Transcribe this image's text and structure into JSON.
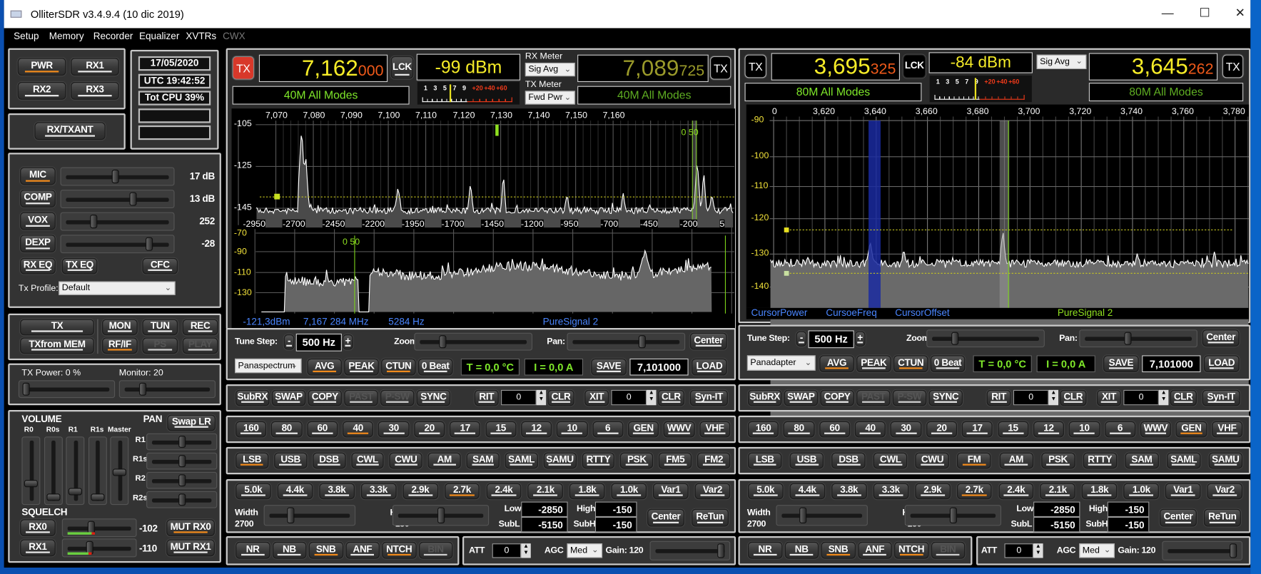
{
  "window": {
    "title": "OlliterSDR v3.4.9.4 (10 dic 2019)",
    "controls": [
      "minimize-icon",
      "maximize-icon",
      "close-icon"
    ]
  },
  "menu": [
    {
      "label": "Setup"
    },
    {
      "label": "Memory"
    },
    {
      "label": "Recorder"
    },
    {
      "label": "Equalizer"
    },
    {
      "label": "XVTRs"
    },
    {
      "label": "CWX",
      "disabled": true
    }
  ],
  "colors": {
    "accent_on": "#f08a1c",
    "freq": "#f6ec28",
    "freq_sub": "#f05a1a",
    "band_label": "#7fe82a",
    "status_text": "#4a86ff",
    "tx_active": "#d8382a"
  },
  "left": {
    "rx_buttons": [
      {
        "label": "PWR",
        "on": true
      },
      {
        "label": "RX1"
      },
      {
        "label": "RX2"
      },
      {
        "label": "RX3"
      }
    ],
    "status": [
      "17/05/2020",
      "UTC 19:42:52",
      "Tot CPU 39%",
      "",
      ""
    ],
    "rxtx_ant": {
      "label": "RX/TXANT"
    },
    "audio": [
      {
        "label": "MIC",
        "on": true,
        "value": "17 dB",
        "level": 0.48
      },
      {
        "label": "COMP",
        "value": "13 dB",
        "level": 0.66
      },
      {
        "label": "VOX",
        "value": "252",
        "level": 0.26
      },
      {
        "label": "DEXP",
        "value": "-28",
        "level": 0.82
      }
    ],
    "eq_buttons": [
      {
        "label": "RX EQ"
      },
      {
        "label": "TX EQ"
      },
      {
        "label": "CFC"
      }
    ],
    "tx_profile": {
      "label": "Tx Profile:",
      "value": "Default"
    },
    "tx_buttons": [
      {
        "label": "TX"
      },
      {
        "label": "TXfrom MEM"
      },
      {
        "label": "MON"
      },
      {
        "label": "TUN"
      },
      {
        "label": "REC"
      },
      {
        "label": "RF/IF",
        "on": true
      },
      {
        "label": "PS",
        "disabled": true
      },
      {
        "label": "PLAY",
        "disabled": true
      }
    ],
    "tx_power": {
      "label": "TX Power:  0 %",
      "level": 0.0
    },
    "monitor": {
      "label": "Monitor: 20",
      "level": 0.2
    },
    "volume": {
      "title": "VOLUME",
      "channels": [
        {
          "label": "R0",
          "level": 0.25
        },
        {
          "label": "R0s",
          "level": 0.0
        },
        {
          "label": "R1",
          "level": 0.1
        },
        {
          "label": "R1s",
          "level": 0.0
        },
        {
          "label": "Master",
          "level": 0.45
        }
      ]
    },
    "pan": {
      "title": "PAN",
      "swap": {
        "label": "Swap LR"
      },
      "channels": [
        {
          "label": "R1",
          "level": 0.5
        },
        {
          "label": "R1s",
          "level": 0.5
        },
        {
          "label": "R2",
          "level": 0.5
        },
        {
          "label": "R2s",
          "level": 0.5
        }
      ]
    },
    "squelch": {
      "title": "SQUELCH",
      "rows": [
        {
          "button": {
            "label": "RX0"
          },
          "value": "-102",
          "level": 0.36,
          "signal": 0.38,
          "mute": {
            "label": "MUT RX0",
            "on": true
          }
        },
        {
          "button": {
            "label": "RX1"
          },
          "value": "-110",
          "level": 0.34,
          "signal": 0.33,
          "mute": {
            "label": "MUT RX1"
          }
        }
      ]
    }
  },
  "rx": [
    {
      "tx": {
        "label": "TX",
        "active": true
      },
      "freq_main": "7,162",
      "freq_sub": "000",
      "lock": {
        "label": "LCK"
      },
      "meter_reading": "-99 dBm",
      "meter_scale": [
        "1",
        "3",
        "5",
        "7",
        "9",
        "+20",
        "+40",
        "+60"
      ],
      "meter_level": 0.3,
      "rx_meter": {
        "label": "RX Meter",
        "value": "Sig Avg"
      },
      "tx_meter": {
        "label": "TX Meter",
        "value": "Fwd Pwr"
      },
      "vfo_b": {
        "freq_main": "7,089",
        "freq_sub": "725",
        "tx": {
          "label": "TX"
        }
      },
      "band_label": "40M All Modes",
      "band_label_b": "40M All Modes",
      "spectrum": {
        "freq_ticks": [
          "7,070",
          "7,080",
          "7,090",
          "7,100",
          "7,110",
          "7,120",
          "7,130",
          "7,140",
          "7,150",
          "7,160"
        ],
        "db_ticks": [
          "-105",
          "-125",
          "-145"
        ],
        "offset_ticks": [
          "-2950",
          "-2700",
          "-2450",
          "-2200",
          "-1950",
          "-1700",
          "-1450",
          "-1200",
          "-950",
          "-700",
          "-450",
          "-200",
          "5"
        ],
        "lower_db_ticks": [
          "-70",
          "-90",
          "-110",
          "-130"
        ],
        "marker_label": "0 50",
        "lower_marker_label": "0 50"
      },
      "status": [
        "-121,3dBm",
        "7,167 284 MHz",
        "5284 Hz",
        "PureSignal 2"
      ],
      "tune_step": {
        "label": "Tune Step:",
        "value": "500 Hz",
        "minus": "-",
        "plus": "+"
      },
      "zoom": {
        "label": "Zoom:",
        "level": 0.2
      },
      "pan": {
        "label": "Pan:",
        "level": 0.66
      },
      "center": {
        "label": "Center"
      },
      "display_mode": "Panaspectrum",
      "display_buttons": [
        {
          "label": "AVG",
          "on": true
        },
        {
          "label": "PEAK"
        },
        {
          "label": "CTUN",
          "on": true
        },
        {
          "label": "0 Beat"
        }
      ],
      "temp": "T = 0,0 °C",
      "current": "I = 0,0 A",
      "save": {
        "label": "SAVE"
      },
      "memory_freq": "7,101000",
      "load": {
        "label": "LOAD"
      },
      "vfo_buttons": [
        {
          "label": "SubRX"
        },
        {
          "label": "SWAP"
        },
        {
          "label": "COPY"
        },
        {
          "label": "PAST",
          "disabled": true
        },
        {
          "label": "P-SW",
          "disabled": true
        },
        {
          "label": "SYNC"
        }
      ],
      "rit": {
        "label": "RIT",
        "value": "0",
        "clear": "CLR"
      },
      "xit": {
        "label": "XIT",
        "value": "0",
        "clear": "CLR"
      },
      "sync_it": {
        "label": "Syn-IT"
      },
      "bands": [
        {
          "label": "160"
        },
        {
          "label": "80"
        },
        {
          "label": "60"
        },
        {
          "label": "40",
          "on": true
        },
        {
          "label": "30"
        },
        {
          "label": "20"
        },
        {
          "label": "17"
        },
        {
          "label": "15"
        },
        {
          "label": "12"
        },
        {
          "label": "10"
        },
        {
          "label": "6"
        },
        {
          "label": "GEN"
        },
        {
          "label": "WWV"
        },
        {
          "label": "VHF"
        }
      ],
      "modes": [
        {
          "label": "LSB",
          "on": true
        },
        {
          "label": "USB"
        },
        {
          "label": "DSB"
        },
        {
          "label": "CWL"
        },
        {
          "label": "CWU"
        },
        {
          "label": "AM"
        },
        {
          "label": "SAM"
        },
        {
          "label": "SAML"
        },
        {
          "label": "SAMU"
        },
        {
          "label": "RTTY"
        },
        {
          "label": "PSK"
        },
        {
          "label": "FM5"
        },
        {
          "label": "FM2"
        }
      ],
      "filters": [
        {
          "label": "5.0k"
        },
        {
          "label": "4.4k"
        },
        {
          "label": "3.8k"
        },
        {
          "label": "3.3k"
        },
        {
          "label": "2.9k"
        },
        {
          "label": "2.7k",
          "on": true
        },
        {
          "label": "2.4k"
        },
        {
          "label": "2.1k"
        },
        {
          "label": "1.8k"
        },
        {
          "label": "1.0k"
        },
        {
          "label": "Var1"
        },
        {
          "label": "Var2"
        }
      ],
      "filter": {
        "width_label": "Width",
        "width": "2700",
        "width_level": 0.25,
        "high_label": "High:",
        "high": "-150",
        "high_level": 0.5,
        "low_label": "Low",
        "low": "-2850",
        "subl_label": "SubL",
        "subl": "-5150",
        "high2_label": "High",
        "high2": "-150",
        "subh_label": "SubH",
        "subh": "-150",
        "center": {
          "label": "Center"
        },
        "retune": {
          "label": "ReTun"
        }
      },
      "dsp": [
        {
          "label": "NR"
        },
        {
          "label": "NB"
        },
        {
          "label": "SNB",
          "on": true
        },
        {
          "label": "ANF"
        },
        {
          "label": "NTCH",
          "on": true
        },
        {
          "label": "BIN",
          "disabled": true
        }
      ],
      "att": {
        "label": "ATT",
        "value": "0"
      },
      "agc": {
        "label": "AGC",
        "value": "Med"
      },
      "gain": {
        "label": "Gain: 120",
        "level": 0.97
      }
    },
    {
      "tx": {
        "label": "TX",
        "active": false
      },
      "freq_main": "3,695",
      "freq_sub": "325",
      "lock": {
        "label": "LCK"
      },
      "meter_reading": "-84 dBm",
      "meter_scale": [
        "1",
        "3",
        "5",
        "7",
        "9",
        "+20",
        "+40",
        "+60"
      ],
      "meter_level": 0.45,
      "rx_meter": {
        "value": "Sig Avg"
      },
      "vfo_b": {
        "freq_main": "3,645",
        "freq_sub": "262",
        "tx": {
          "label": "TX"
        }
      },
      "band_label": "80M All Modes",
      "band_label_b": "80M All Modes",
      "spectrum": {
        "freq_ticks": [
          "0",
          "3,620",
          "3,640",
          "3,660",
          "3,680",
          "3,700",
          "3,720",
          "3,740",
          "3,760",
          "3,780"
        ],
        "db_ticks": [
          "-90",
          "-100",
          "-110",
          "-120",
          "-130",
          "-140"
        ]
      },
      "status": [
        "CursorPower",
        "CursoeFreq",
        "CursorOffset",
        "PureSignal 2"
      ],
      "tune_step": {
        "label": "Tune Step:",
        "value": "500 Hz",
        "minus": "-",
        "plus": "+"
      },
      "zoom": {
        "label": "Zoom:",
        "level": 0.2
      },
      "pan": {
        "label": "Pan:",
        "level": 0.4
      },
      "center": {
        "label": "Center"
      },
      "display_mode": "Panadapter",
      "display_buttons": [
        {
          "label": "AVG",
          "on": true
        },
        {
          "label": "PEAK"
        },
        {
          "label": "CTUN",
          "on": true
        },
        {
          "label": "0 Beat"
        }
      ],
      "temp": "T = 0,0 °C",
      "current": "I = 0,0 A",
      "save": {
        "label": "SAVE"
      },
      "memory_freq": "7,101000",
      "load": {
        "label": "LOAD"
      },
      "vfo_buttons": [
        {
          "label": "SubRX"
        },
        {
          "label": "SWAP"
        },
        {
          "label": "COPY"
        },
        {
          "label": "PAST",
          "disabled": true
        },
        {
          "label": "P-SW",
          "disabled": true
        },
        {
          "label": "SYNC"
        }
      ],
      "rit": {
        "label": "RIT",
        "value": "0",
        "clear": "CLR"
      },
      "xit": {
        "label": "XIT",
        "value": "0",
        "clear": "CLR"
      },
      "sync_it": {
        "label": "Syn-IT"
      },
      "bands": [
        {
          "label": "160"
        },
        {
          "label": "80"
        },
        {
          "label": "60"
        },
        {
          "label": "40"
        },
        {
          "label": "30"
        },
        {
          "label": "20"
        },
        {
          "label": "17"
        },
        {
          "label": "15"
        },
        {
          "label": "12"
        },
        {
          "label": "10"
        },
        {
          "label": "6"
        },
        {
          "label": "WWV"
        },
        {
          "label": "GEN",
          "on": true
        },
        {
          "label": "VHF"
        }
      ],
      "modes": [
        {
          "label": "LSB"
        },
        {
          "label": "USB"
        },
        {
          "label": "DSB"
        },
        {
          "label": "CWL"
        },
        {
          "label": "CWU"
        },
        {
          "label": "FM",
          "on": true
        },
        {
          "label": "AM"
        },
        {
          "label": "PSK"
        },
        {
          "label": "RTTY"
        },
        {
          "label": "SAM"
        },
        {
          "label": "SAML"
        },
        {
          "label": "SAMU"
        }
      ],
      "filters": [
        {
          "label": "5.0k"
        },
        {
          "label": "4.4k"
        },
        {
          "label": "3.8k"
        },
        {
          "label": "3.3k"
        },
        {
          "label": "2.9k"
        },
        {
          "label": "2.7k",
          "on": true
        },
        {
          "label": "2.4k"
        },
        {
          "label": "2.1k"
        },
        {
          "label": "1.8k"
        },
        {
          "label": "1.0k"
        },
        {
          "label": "Var1"
        },
        {
          "label": "Var2"
        }
      ],
      "filter": {
        "width_label": "Width",
        "width": "2700",
        "width_level": 0.25,
        "high_label": "High:",
        "high": "-150",
        "high_level": 0.5,
        "low_label": "Low",
        "low": "-2850",
        "subl_label": "SubL",
        "subl": "-5150",
        "high2_label": "High",
        "high2": "-150",
        "subh_label": "SubH",
        "subh": "-150",
        "center": {
          "label": "Center"
        },
        "retune": {
          "label": "ReTun"
        }
      },
      "dsp": [
        {
          "label": "NR"
        },
        {
          "label": "NB"
        },
        {
          "label": "SNB",
          "on": true
        },
        {
          "label": "ANF"
        },
        {
          "label": "NTCH",
          "on": true
        },
        {
          "label": "BIN",
          "disabled": true
        }
      ],
      "att": {
        "label": "ATT",
        "value": "0"
      },
      "agc": {
        "label": "AGC",
        "value": "Med"
      },
      "gain": {
        "label": "Gain: 120",
        "level": 0.97
      }
    }
  ]
}
